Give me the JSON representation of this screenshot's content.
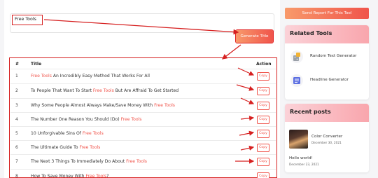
{
  "generator": {
    "input_value": "Free Tools",
    "generate_label": "Generate Title"
  },
  "table": {
    "col_num": "#",
    "col_title": "Title",
    "col_action": "Action",
    "keyword": "Free Tools",
    "copy_label": "Copy",
    "rows": [
      {
        "num": "1",
        "pre": "",
        "post": " An Incredibly Easy Method That Works For All"
      },
      {
        "num": "2",
        "pre": "To People That Want To Start ",
        "post": " But Are Affraid To Get Started"
      },
      {
        "num": "3",
        "pre": "Why Some People Almost Always Make/Save Money With ",
        "post": ""
      },
      {
        "num": "4",
        "pre": "The Number One Reason You Should (Do) ",
        "post": ""
      },
      {
        "num": "5",
        "pre": "10 Unforgivable Sins Of ",
        "post": ""
      },
      {
        "num": "6",
        "pre": "The Ultimate Guide To ",
        "post": ""
      },
      {
        "num": "7",
        "pre": "The Next 3 Things To Immediately Do About ",
        "post": ""
      },
      {
        "num": "8",
        "pre": "How To Save Money With ",
        "post": "?"
      }
    ]
  },
  "sidebar": {
    "send_report_label": "Send Report For This Tool",
    "related_title": "Related Tools",
    "related_tools": [
      {
        "label": "Random Text Generator",
        "icon": "dice-icon"
      },
      {
        "label": "Headline Generator",
        "icon": "headline-icon"
      }
    ],
    "recent_title": "Recent posts",
    "posts": [
      {
        "title": "Color Converter",
        "date": "December 30, 2021"
      },
      {
        "title": "Hello world!",
        "date": "December 23, 2021"
      }
    ]
  },
  "colors": {
    "accent": "#f0544b",
    "annotation": "#d62020"
  }
}
